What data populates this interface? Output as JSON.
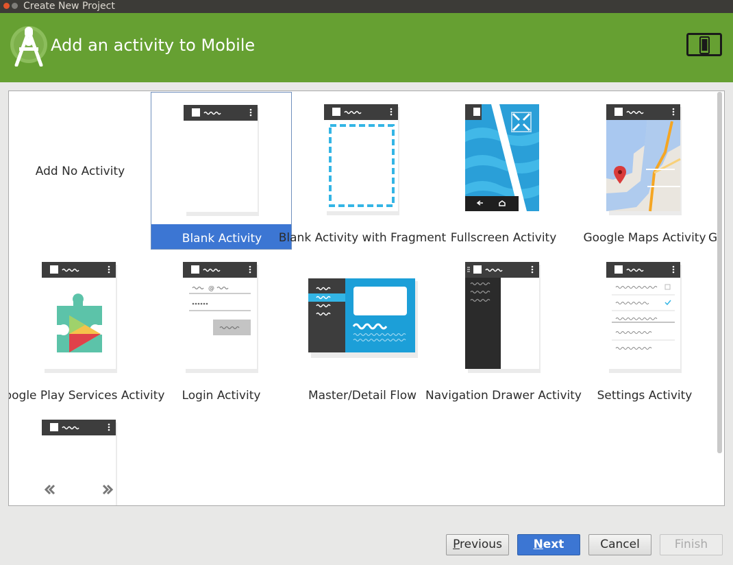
{
  "window": {
    "title": "Create New Project"
  },
  "header": {
    "title": "Add an activity to Mobile"
  },
  "gallery": {
    "no_activity_label": "Add No Activity",
    "activities": [
      {
        "label": "Blank Activity",
        "selected": true,
        "icon": "blank-activity-thumbnail"
      },
      {
        "label": "Blank Activity with Fragment",
        "icon": "fragment-activity-thumbnail"
      },
      {
        "label": "Fullscreen Activity",
        "icon": "fullscreen-activity-thumbnail"
      },
      {
        "label": "Google Maps Activity",
        "icon": "maps-activity-thumbnail"
      },
      {
        "label": "Google Play Services Activity",
        "icon": "play-services-thumbnail"
      },
      {
        "label": "Login Activity",
        "icon": "login-activity-thumbnail"
      },
      {
        "label": "Master/Detail Flow",
        "icon": "master-detail-thumbnail"
      },
      {
        "label": "Navigation Drawer Activity",
        "icon": "nav-drawer-thumbnail"
      },
      {
        "label": "Settings Activity",
        "icon": "settings-activity-thumbnail"
      }
    ],
    "overflow_label": "G"
  },
  "buttons": {
    "previous": {
      "mnemonic": "P",
      "rest": "revious"
    },
    "next": {
      "mnemonic": "N",
      "rest": "ext"
    },
    "cancel": "Cancel",
    "finish": "Finish"
  },
  "colors": {
    "header_green": "#66a032",
    "selection_blue": "#3c76d3",
    "holo_blue": "#33b5e5"
  }
}
